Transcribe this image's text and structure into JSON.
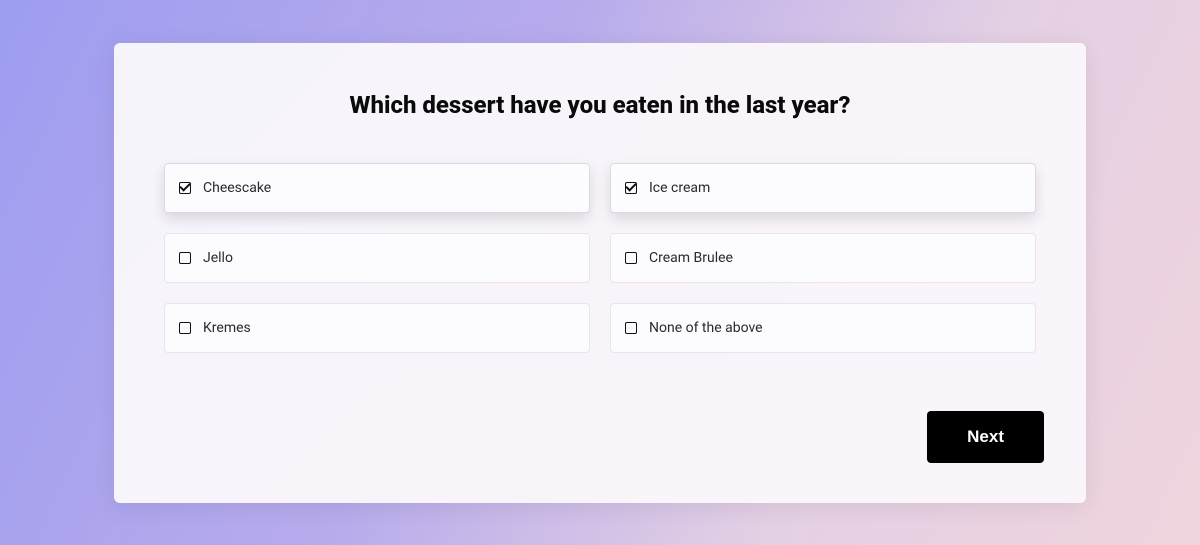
{
  "question": "Which dessert have you eaten in the last year?",
  "options": [
    {
      "label": "Cheescake",
      "checked": true
    },
    {
      "label": "Ice cream",
      "checked": true
    },
    {
      "label": "Jello",
      "checked": false
    },
    {
      "label": "Cream Brulee",
      "checked": false
    },
    {
      "label": "Kremes",
      "checked": false
    },
    {
      "label": "None of the above",
      "checked": false
    }
  ],
  "nextLabel": "Next"
}
